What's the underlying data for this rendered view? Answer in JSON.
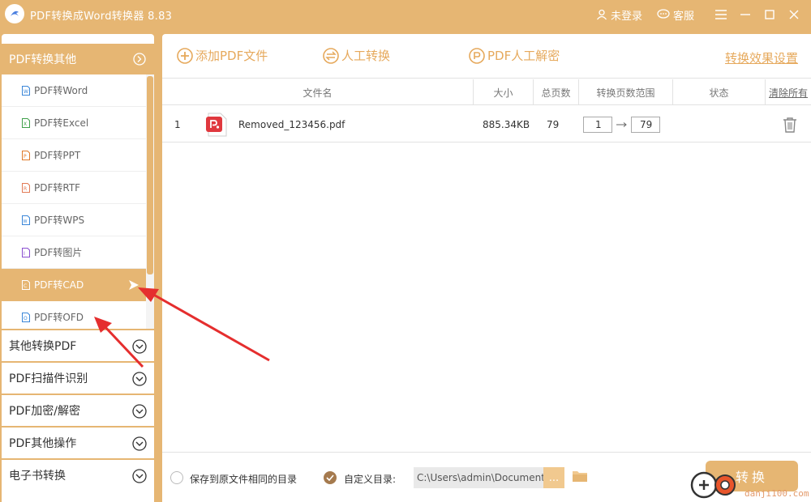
{
  "app": {
    "title": "PDF转换成Word转换器 8.83",
    "accent": "#e6b673"
  },
  "titlebar": {
    "login_label": "未登录",
    "service_label": "客服"
  },
  "sidebar": {
    "active_group": "PDF转换其他",
    "sub_items": [
      {
        "label": "PDF转Word",
        "icon": "word-file-icon",
        "color": "#3a86d8"
      },
      {
        "label": "PDF转Excel",
        "icon": "excel-file-icon",
        "color": "#3fa04a"
      },
      {
        "label": "PDF转PPT",
        "icon": "ppt-file-icon",
        "color": "#e07a2a"
      },
      {
        "label": "PDF转RTF",
        "icon": "rtf-file-icon",
        "color": "#e27a55"
      },
      {
        "label": "PDF转WPS",
        "icon": "wps-file-icon",
        "color": "#3a86d8"
      },
      {
        "label": "PDF转图片",
        "icon": "image-file-icon",
        "color": "#8a4fd0"
      },
      {
        "label": "PDF转CAD",
        "icon": "cad-file-icon",
        "color": "#ffffff"
      },
      {
        "label": "PDF转OFD",
        "icon": "ofd-file-icon",
        "color": "#3a86d8"
      }
    ],
    "groups": [
      "其他转换PDF",
      "PDF扫描件识别",
      "PDF加密/解密",
      "PDF其他操作",
      "电子书转换"
    ]
  },
  "toolbar": {
    "add_file": "添加PDF文件",
    "manual_convert": "人工转换",
    "manual_decrypt": "PDF人工解密",
    "settings": "转换效果设置"
  },
  "table": {
    "headers": {
      "name": "文件名",
      "size": "大小",
      "pages": "总页数",
      "range": "转换页数范围",
      "status": "状态",
      "clear": "清除所有"
    },
    "rows": [
      {
        "index": "1",
        "name": "Removed_123456.pdf",
        "size": "885.34KB",
        "pages": "79",
        "range_from": "1",
        "range_to": "79"
      }
    ]
  },
  "bottom": {
    "same_dir_label": "保存到原文件相同的目录",
    "custom_dir_label": "自定义目录:",
    "path": "C:\\Users\\admin\\Documents",
    "browse_label": "...",
    "convert_label": "转换",
    "watermark": "danji100.com"
  }
}
